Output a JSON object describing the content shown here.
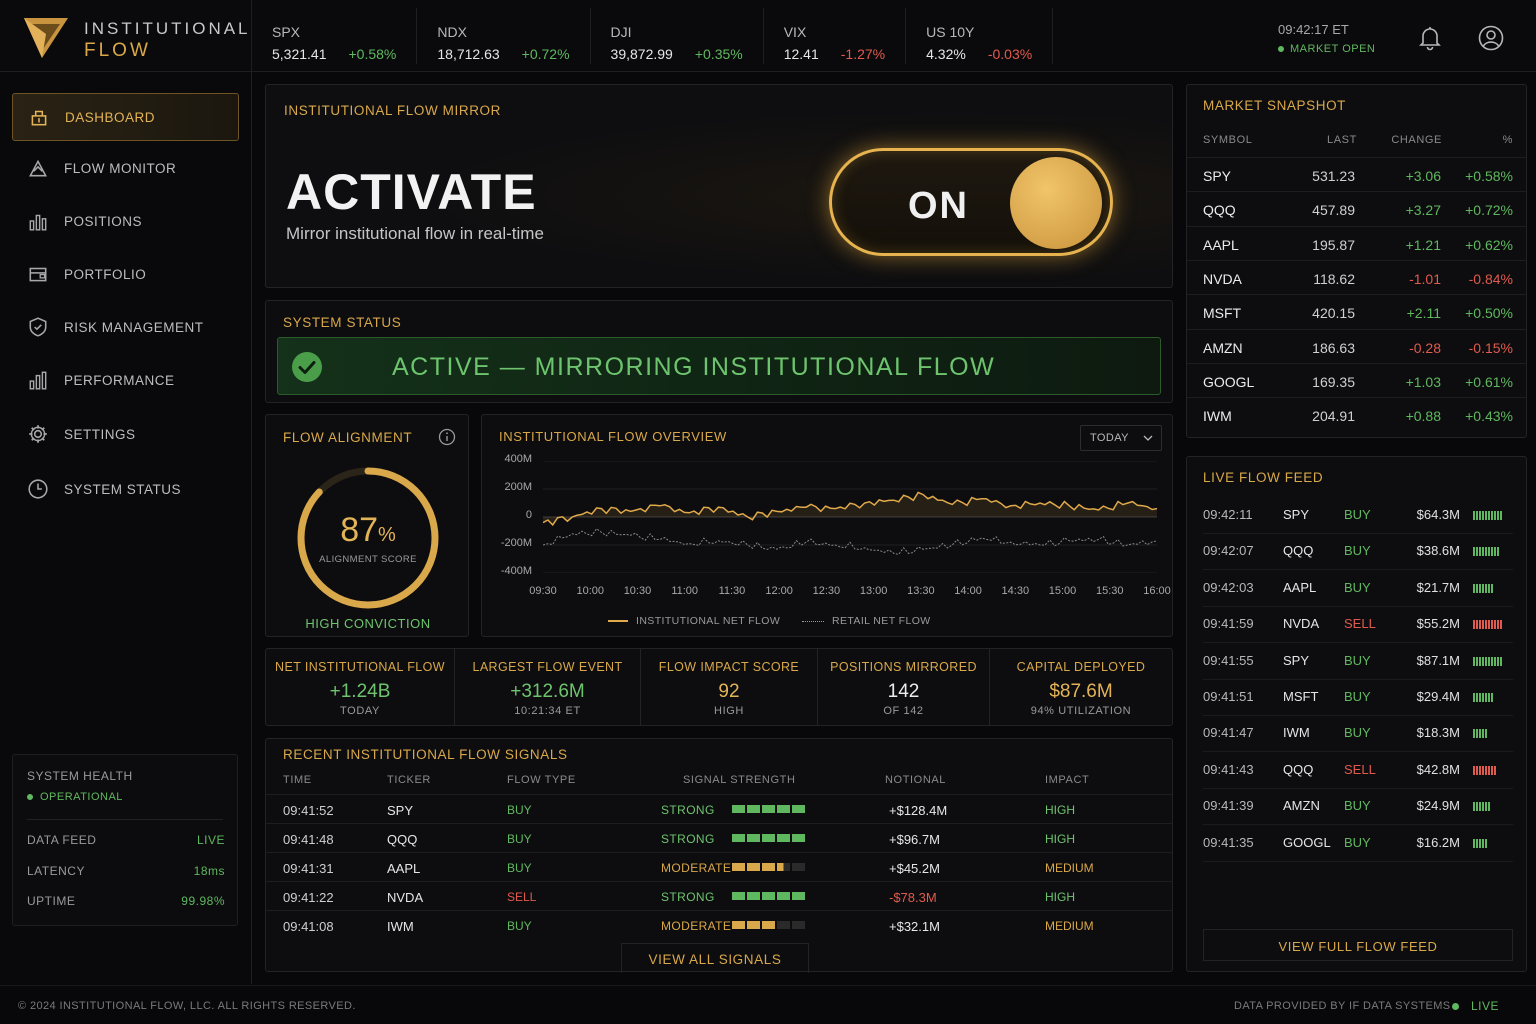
{
  "brand": {
    "line1": "INSTITUTIONAL",
    "line2": "FLOW"
  },
  "tickers": [
    {
      "name": "SPX",
      "value": "5,321.41",
      "change": "+0.58%",
      "dir": "up"
    },
    {
      "name": "NDX",
      "value": "18,712.63",
      "change": "+0.72%",
      "dir": "up"
    },
    {
      "name": "DJI",
      "value": "39,872.99",
      "change": "+0.35%",
      "dir": "up"
    },
    {
      "name": "VIX",
      "value": "12.41",
      "change": "-1.27%",
      "dir": "down"
    },
    {
      "name": "US 10Y",
      "value": "4.32%",
      "change": "-0.03%",
      "dir": "down"
    }
  ],
  "clock": {
    "time": "09:42:17 ET",
    "status": "MARKET OPEN"
  },
  "icons": {
    "notifications": "bell-icon",
    "account": "user-icon",
    "status_ok": "check-icon"
  },
  "nav": [
    {
      "label": "DASHBOARD",
      "icon": "dashboard-icon",
      "active": true
    },
    {
      "label": "FLOW MONITOR",
      "icon": "flow-monitor-icon",
      "active": false
    },
    {
      "label": "POSITIONS",
      "icon": "positions-icon",
      "active": false
    },
    {
      "label": "PORTFOLIO",
      "icon": "portfolio-icon",
      "active": false
    },
    {
      "label": "RISK MANAGEMENT",
      "icon": "shield-icon",
      "active": false
    },
    {
      "label": "PERFORMANCE",
      "icon": "performance-icon",
      "active": false
    },
    {
      "label": "SETTINGS",
      "icon": "gear-icon",
      "active": false
    },
    {
      "label": "SYSTEM STATUS",
      "icon": "clock-icon",
      "active": false
    }
  ],
  "health": {
    "title": "SYSTEM HEALTH",
    "state": "OPERATIONAL",
    "rows": [
      {
        "label": "DATA FEED",
        "value": "LIVE"
      },
      {
        "label": "LATENCY",
        "value": "18ms"
      },
      {
        "label": "UPTIME",
        "value": "99.98%"
      }
    ]
  },
  "mirror": {
    "title": "INSTITUTIONAL FLOW MIRROR",
    "heading": "ACTIVATE",
    "subtitle": "Mirror institutional flow in real-time",
    "toggle_label": "ON",
    "toggle_on": true
  },
  "system_status": {
    "title": "SYSTEM STATUS",
    "message": "ACTIVE — MIRRORING INSTITUTIONAL FLOW"
  },
  "alignment": {
    "title": "FLOW ALIGNMENT",
    "score": "87",
    "unit": "%",
    "score_fraction": 0.87,
    "score_label": "ALIGNMENT SCORE",
    "conviction": "HIGH CONVICTION"
  },
  "overview": {
    "title": "INSTITUTIONAL FLOW OVERVIEW",
    "range_select": "TODAY",
    "chart_data": {
      "type": "line",
      "title": "",
      "y_ticks": [
        "400M",
        "200M",
        "0",
        "-200M",
        "-400M"
      ],
      "ylim": [
        -400,
        400
      ],
      "x_ticks": [
        "09:30",
        "10:00",
        "10:30",
        "11:00",
        "11:30",
        "12:00",
        "12:30",
        "13:00",
        "13:30",
        "14:00",
        "14:30",
        "15:00",
        "15:30",
        "16:00"
      ],
      "series": [
        {
          "name": "INSTITUTIONAL NET FLOW",
          "color": "#e0a94a",
          "values": [
            -40,
            0,
            60,
            40,
            80,
            30,
            70,
            0,
            40,
            70,
            60,
            100,
            120,
            160,
            90,
            130,
            80,
            100,
            80,
            50,
            100,
            60
          ]
        },
        {
          "name": "RETAIL NET FLOW",
          "color": "#8a8a8a",
          "values": [
            -200,
            -120,
            -110,
            -130,
            -160,
            -190,
            -170,
            -200,
            -230,
            -180,
            -200,
            -220,
            -260,
            -230,
            -200,
            -150,
            -180,
            -200,
            -170,
            -160,
            -200,
            -170
          ]
        }
      ]
    }
  },
  "metrics": [
    {
      "title": "NET INSTITUTIONAL FLOW",
      "value": "+1.24B",
      "sub": "TODAY",
      "tone": "green"
    },
    {
      "title": "LARGEST FLOW EVENT",
      "value": "+312.6M",
      "sub": "10:21:34 ET",
      "tone": "green"
    },
    {
      "title": "FLOW IMPACT SCORE",
      "value": "92",
      "sub": "HIGH",
      "tone": "gold"
    },
    {
      "title": "POSITIONS MIRRORED",
      "value": "142",
      "sub": "OF 142",
      "tone": "white"
    },
    {
      "title": "CAPITAL DEPLOYED",
      "value": "$87.6M",
      "sub": "94% UTILIZATION",
      "tone": "gold"
    }
  ],
  "signals": {
    "title": "RECENT INSTITUTIONAL FLOW SIGNALS",
    "columns": [
      "TIME",
      "TICKER",
      "FLOW TYPE",
      "SIGNAL STRENGTH",
      "NOTIONAL",
      "IMPACT"
    ],
    "rows": [
      {
        "time": "09:41:52",
        "ticker": "SPY",
        "type": "BUY",
        "strength": "STRONG",
        "level": 5,
        "notional": "+$128.4M",
        "impact": "HIGH"
      },
      {
        "time": "09:41:48",
        "ticker": "QQQ",
        "type": "BUY",
        "strength": "STRONG",
        "level": 5,
        "notional": "+$96.7M",
        "impact": "HIGH"
      },
      {
        "time": "09:41:31",
        "ticker": "AAPL",
        "type": "BUY",
        "strength": "MODERATE",
        "level": 3.5,
        "notional": "+$45.2M",
        "impact": "MEDIUM"
      },
      {
        "time": "09:41:22",
        "ticker": "NVDA",
        "type": "SELL",
        "strength": "STRONG",
        "level": 5,
        "notional": "-$78.3M",
        "impact": "HIGH"
      },
      {
        "time": "09:41:08",
        "ticker": "IWM",
        "type": "BUY",
        "strength": "MODERATE",
        "level": 3,
        "notional": "+$32.1M",
        "impact": "MEDIUM"
      }
    ],
    "view_all": "VIEW ALL SIGNALS"
  },
  "snapshot": {
    "title": "MARKET SNAPSHOT",
    "columns": [
      "SYMBOL",
      "LAST",
      "CHANGE",
      "%"
    ],
    "rows": [
      {
        "symbol": "SPY",
        "last": "531.23",
        "change": "+3.06",
        "pct": "+0.58%",
        "dir": "up"
      },
      {
        "symbol": "QQQ",
        "last": "457.89",
        "change": "+3.27",
        "pct": "+0.72%",
        "dir": "up"
      },
      {
        "symbol": "AAPL",
        "last": "195.87",
        "change": "+1.21",
        "pct": "+0.62%",
        "dir": "up"
      },
      {
        "symbol": "NVDA",
        "last": "118.62",
        "change": "-1.01",
        "pct": "-0.84%",
        "dir": "down"
      },
      {
        "symbol": "MSFT",
        "last": "420.15",
        "change": "+2.11",
        "pct": "+0.50%",
        "dir": "up"
      },
      {
        "symbol": "AMZN",
        "last": "186.63",
        "change": "-0.28",
        "pct": "-0.15%",
        "dir": "down"
      },
      {
        "symbol": "GOOGL",
        "last": "169.35",
        "change": "+1.03",
        "pct": "+0.61%",
        "dir": "up"
      },
      {
        "symbol": "IWM",
        "last": "204.91",
        "change": "+0.88",
        "pct": "+0.43%",
        "dir": "up"
      }
    ]
  },
  "feed": {
    "title": "LIVE FLOW FEED",
    "rows": [
      {
        "time": "09:42:11",
        "ticker": "SPY",
        "type": "BUY",
        "amount": "$64.3M",
        "level": 10
      },
      {
        "time": "09:42:07",
        "ticker": "QQQ",
        "type": "BUY",
        "amount": "$38.6M",
        "level": 9
      },
      {
        "time": "09:42:03",
        "ticker": "AAPL",
        "type": "BUY",
        "amount": "$21.7M",
        "level": 7
      },
      {
        "time": "09:41:59",
        "ticker": "NVDA",
        "type": "SELL",
        "amount": "$55.2M",
        "level": 10
      },
      {
        "time": "09:41:55",
        "ticker": "SPY",
        "type": "BUY",
        "amount": "$87.1M",
        "level": 10
      },
      {
        "time": "09:41:51",
        "ticker": "MSFT",
        "type": "BUY",
        "amount": "$29.4M",
        "level": 7
      },
      {
        "time": "09:41:47",
        "ticker": "IWM",
        "type": "BUY",
        "amount": "$18.3M",
        "level": 5
      },
      {
        "time": "09:41:43",
        "ticker": "QQQ",
        "type": "SELL",
        "amount": "$42.8M",
        "level": 8
      },
      {
        "time": "09:41:39",
        "ticker": "AMZN",
        "type": "BUY",
        "amount": "$24.9M",
        "level": 6
      },
      {
        "time": "09:41:35",
        "ticker": "GOOGL",
        "type": "BUY",
        "amount": "$16.2M",
        "level": 5
      }
    ],
    "view_full": "VIEW FULL FLOW FEED"
  },
  "footer": {
    "copyright": "© 2024 INSTITUTIONAL FLOW, LLC. ALL RIGHTS RESERVED.",
    "provider": "DATA PROVIDED BY IF DATA SYSTEMS",
    "live": "LIVE"
  },
  "colors": {
    "accent": "#d9a84a",
    "positive": "#5fb85f",
    "negative": "#e05a4e"
  }
}
